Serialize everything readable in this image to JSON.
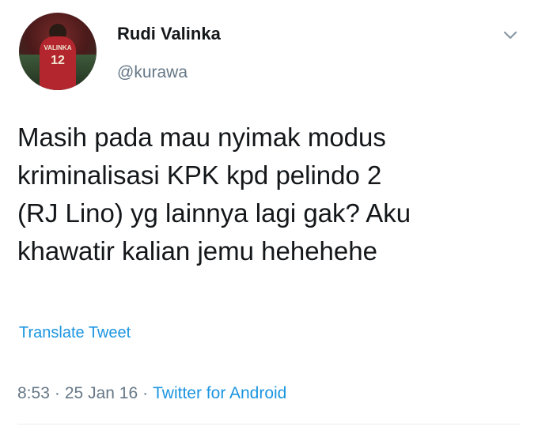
{
  "author": {
    "display_name": "Rudi Valinka",
    "handle": "@kurawa",
    "avatar_shirt_text": "VALINKA",
    "avatar_shirt_number": "12"
  },
  "tweet": {
    "lines": [
      "Masih pada mau nyimak modus",
      "kriminalisasi KPK kpd pelindo 2",
      "(RJ Lino) yg lainnya lagi gak? Aku",
      "khawatir kalian jemu hehehehe"
    ],
    "translate_label": "Translate Tweet",
    "time": "8:53",
    "date": "25 Jan 16",
    "separator": "·",
    "source": "Twitter for Android"
  },
  "icons": {
    "menu": "chevron-down-icon"
  },
  "colors": {
    "link": "#1b95e0",
    "secondary_text": "#657786",
    "primary_text": "#14171a"
  }
}
